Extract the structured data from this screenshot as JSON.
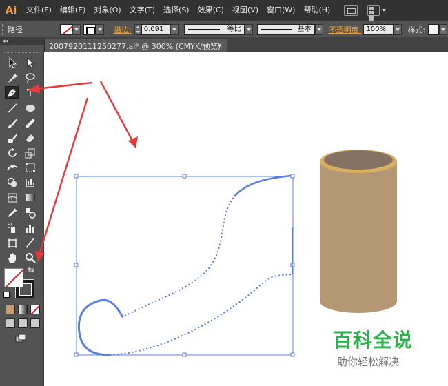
{
  "app": {
    "logo": "Ai"
  },
  "menu": {
    "items": [
      "文件(F)",
      "编辑(E)",
      "对象(O)",
      "文字(T)",
      "选择(S)",
      "效果(C)",
      "视图(V)",
      "窗口(W)",
      "帮助(H)"
    ],
    "icons": [
      "bridge-icon",
      "arrange-documents-icon"
    ]
  },
  "control_bar": {
    "selection_label": "路径",
    "stroke_label": "描边:",
    "stroke_weight": "0.091",
    "variable_width_label": "等比",
    "brush_label": "基本",
    "opacity_label": "不透明度:",
    "opacity_value": "100%",
    "style_label": "样式:"
  },
  "document": {
    "tab_title": "2007920111250277.ai* @ 300% (CMYK/预览)",
    "close_glyph": "×"
  },
  "toolbar": {
    "collapse_glyph": "◂◂",
    "tools": [
      "selection-tool",
      "direct-selection-tool",
      "magic-wand-tool",
      "lasso-tool",
      "pen-tool",
      "type-tool",
      "line-segment-tool",
      "ellipse-tool",
      "paintbrush-tool",
      "pencil-tool",
      "blob-brush-tool",
      "eraser-tool",
      "rotate-tool",
      "scale-tool",
      "width-tool",
      "free-transform-tool",
      "shape-builder-tool",
      "perspective-grid-tool",
      "mesh-tool",
      "gradient-tool",
      "eyedropper-tool",
      "blend-tool",
      "symbol-sprayer-tool",
      "column-graph-tool",
      "artboard-tool",
      "slice-tool",
      "hand-tool",
      "zoom-tool"
    ],
    "active_tool": "pen-tool",
    "fill": "none",
    "stroke": "#000000"
  },
  "colors": {
    "annotation_arrow": "#e83a3a",
    "path_stroke": "#5a7fe0",
    "cylinder_body": "#b39873",
    "cylinder_rim": "#d9b060",
    "cylinder_top": "#857265",
    "opacity_label": "#f0a030"
  },
  "watermark": {
    "title": "百科全说",
    "subtitle": "助你轻松解决"
  }
}
